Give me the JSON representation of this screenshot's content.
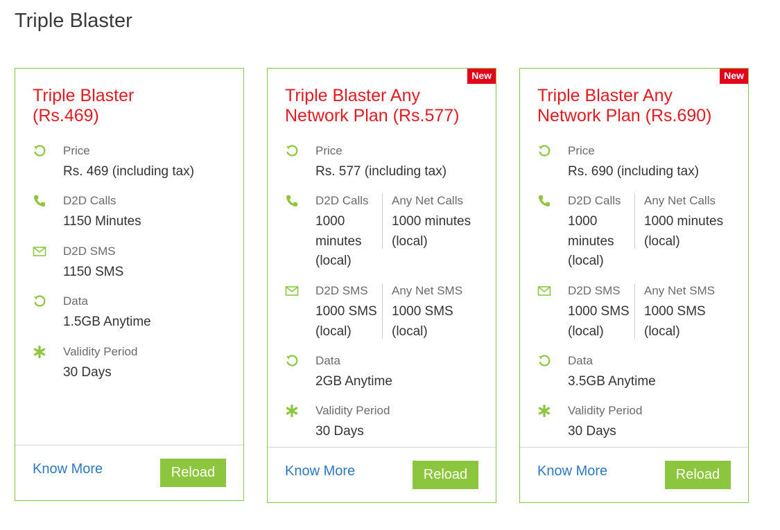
{
  "page_title": "Triple Blaster",
  "colors": {
    "accent_green": "#8cc63f",
    "title_red": "#e21b23",
    "badge_red": "#e4001b",
    "link_blue": "#2e78c0"
  },
  "cards": [
    {
      "title": "Triple Blaster (Rs.469)",
      "badge": "",
      "price_label": "Price",
      "price_value": "Rs. 469 (including tax)",
      "calls_label": "D2D Calls",
      "calls_value": "1150 Minutes",
      "sms_label": "D2D SMS",
      "sms_value": "1150 SMS",
      "data_label": "Data",
      "data_value": "1.5GB Anytime",
      "validity_label": "Validity Period",
      "validity_value": "30 Days",
      "know_more": "Know More",
      "reload": "Reload"
    },
    {
      "title": "Triple Blaster Any Network Plan (Rs.577)",
      "badge": "New",
      "price_label": "Price",
      "price_value": "Rs. 577 (including tax)",
      "calls_label": "D2D Calls",
      "calls_value": "1000 minutes (local)",
      "anynet_calls_label": "Any Net Calls",
      "anynet_calls_value": "1000 minutes (local)",
      "sms_label": "D2D SMS",
      "sms_value": "1000 SMS (local)",
      "anynet_sms_label": "Any Net SMS",
      "anynet_sms_value": "1000 SMS (local)",
      "data_label": "Data",
      "data_value": "2GB Anytime",
      "validity_label": "Validity Period",
      "validity_value": "30 Days",
      "know_more": "Know More",
      "reload": "Reload"
    },
    {
      "title": "Triple Blaster Any Network Plan (Rs.690)",
      "badge": "New",
      "price_label": "Price",
      "price_value": "Rs. 690 (including tax)",
      "calls_label": "D2D Calls",
      "calls_value": "1000 minutes (local)",
      "anynet_calls_label": "Any Net Calls",
      "anynet_calls_value": "1000 minutes (local)",
      "sms_label": "D2D SMS",
      "sms_value": "1000 SMS (local)",
      "anynet_sms_label": "Any Net SMS",
      "anynet_sms_value": "1000 SMS (local)",
      "data_label": "Data",
      "data_value": "3.5GB Anytime",
      "validity_label": "Validity Period",
      "validity_value": "30 Days",
      "know_more": "Know More",
      "reload": "Reload"
    }
  ],
  "icons": {
    "price": "refresh-icon",
    "calls": "phone-icon",
    "sms": "envelope-icon",
    "data": "refresh-icon",
    "validity": "asterisk-icon"
  }
}
